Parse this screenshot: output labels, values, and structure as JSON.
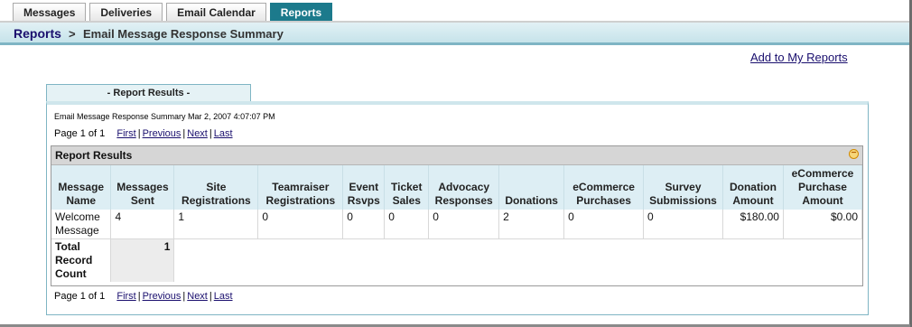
{
  "tabs": [
    {
      "label": "Messages",
      "active": false
    },
    {
      "label": "Deliveries",
      "active": false
    },
    {
      "label": "Email Calendar",
      "active": false
    },
    {
      "label": "Reports",
      "active": true
    }
  ],
  "breadcrumb": {
    "parent": "Reports",
    "separator": ">",
    "current": "Email Message Response Summary"
  },
  "add_to_reports_link": "Add to My Reports",
  "results_tab_label": "- Report Results -",
  "summary_line": "Email Message Response Summary Mar 2, 2007 4:07:07 PM",
  "pager": {
    "page_text": "Page 1 of 1",
    "first": "First",
    "previous": "Previous",
    "next": "Next",
    "last": "Last",
    "separator": "|"
  },
  "report": {
    "title": "Report Results",
    "columns": [
      "Message Name",
      "Messages Sent",
      "Site Registrations",
      "Teamraiser Registrations",
      "Event Rsvps",
      "Ticket Sales",
      "Advocacy Responses",
      "Donations",
      "eCommerce Purchases",
      "Survey Submissions",
      "Donation Amount",
      "eCommerce Purchase Amount"
    ],
    "rows": [
      [
        "Welcome Message",
        "4",
        "1",
        "0",
        "0",
        "0",
        "0",
        "2",
        "0",
        "0",
        "$180.00",
        "$0.00"
      ]
    ],
    "total_label": "Total Record Count",
    "total_value": "1"
  },
  "colors": {
    "active_tab": "#1c7a8c",
    "link": "#1a0f6e",
    "header_bg": "#ddeef4"
  }
}
